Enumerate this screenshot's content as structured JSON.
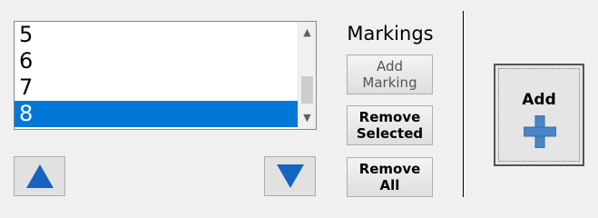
{
  "list": {
    "items": [
      "5",
      "6",
      "7",
      "8"
    ],
    "selected": "8"
  },
  "scrollbar": {
    "up_icon": "▲",
    "down_icon": "▼"
  },
  "markings": {
    "title": "Markings",
    "add_marking_label": "Add\nMarking",
    "remove_selected_label": "Remove\nSelected",
    "remove_all_label": "Remove\nAll"
  },
  "add_button": {
    "label": "Add"
  },
  "colors": {
    "accent": "#0078d7",
    "arrow_blue": "#1565c0",
    "plus_blue": "#4a86c6"
  },
  "icons": {
    "move_up": "move-up-icon",
    "move_down": "move-down-icon",
    "plus": "plus-icon"
  }
}
